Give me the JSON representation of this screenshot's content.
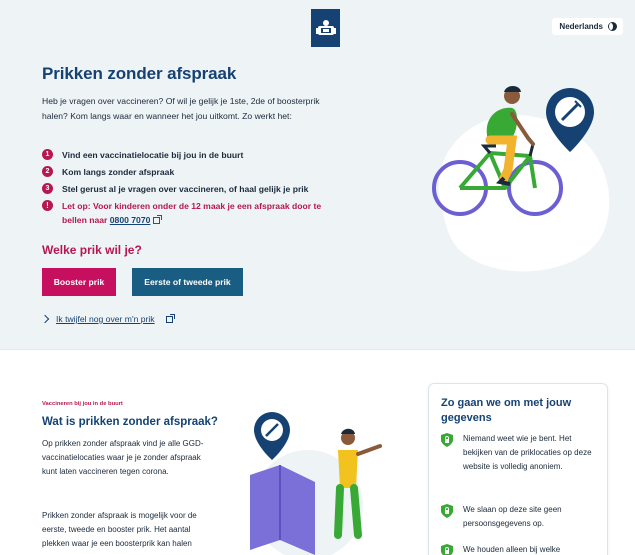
{
  "header": {
    "language_label": "Nederlands"
  },
  "hero": {
    "title": "Prikken zonder afspraak",
    "intro": "Heb je vragen over vaccineren? Of wil je gelijk je 1ste, 2de of boosterprik halen? Kom langs waar en wanneer het jou uitkomt. Zo werkt het:",
    "steps": [
      {
        "num": "1",
        "text": "Vind een vaccinatielocatie bij jou in de buurt"
      },
      {
        "num": "2",
        "text": "Kom langs zonder afspraak"
      },
      {
        "num": "3",
        "text": "Stel gerust al je vragen over vaccineren, of haal gelijk je prik"
      }
    ],
    "warning": {
      "num": "!",
      "text": "Let op: Voor kinderen onder de 12 maak je een afspraak door te bellen naar",
      "phone": "0800 7070"
    },
    "choose_title": "Welke prik wil je?",
    "booster_button": "Booster prik",
    "first_second_button": "Eerste of tweede prik",
    "doubt_link": "Ik twijfel nog over m'n prik"
  },
  "info": {
    "eyebrow": "Vaccineren bij jou in de buurt",
    "title": "Wat is prikken zonder afspraak?",
    "paragraph1": "Op prikken zonder afspraak vind je alle GGD-vaccinatielocaties waar je je zonder afspraak kunt laten vaccineren tegen corona.",
    "paragraph2": "Prikken zonder afspraak is mogelijk voor de eerste, tweede en booster prik. Het aantal plekken waar je een boosterprik kan halen"
  },
  "privacy_card": {
    "title": "Zo gaan we om met jouw gegevens",
    "items": [
      "Niemand weet wie je bent. Het bekijken van de priklocaties op deze website is volledig anoniem.",
      "We slaan op deze site geen persoonsgegevens op.",
      "We houden alleen bij welke"
    ]
  },
  "colors": {
    "primary_blue": "#154273",
    "accent_magenta": "#c6105f",
    "button_blue": "#1a5d82",
    "hero_background": "#eef3f6",
    "shield_green": "#39a935"
  },
  "icons": [
    "rijksoverheid-logo-icon",
    "globe-icon",
    "chevron-right-icon",
    "external-link-icon",
    "shield-icon",
    "syringe-pin-icon"
  ]
}
